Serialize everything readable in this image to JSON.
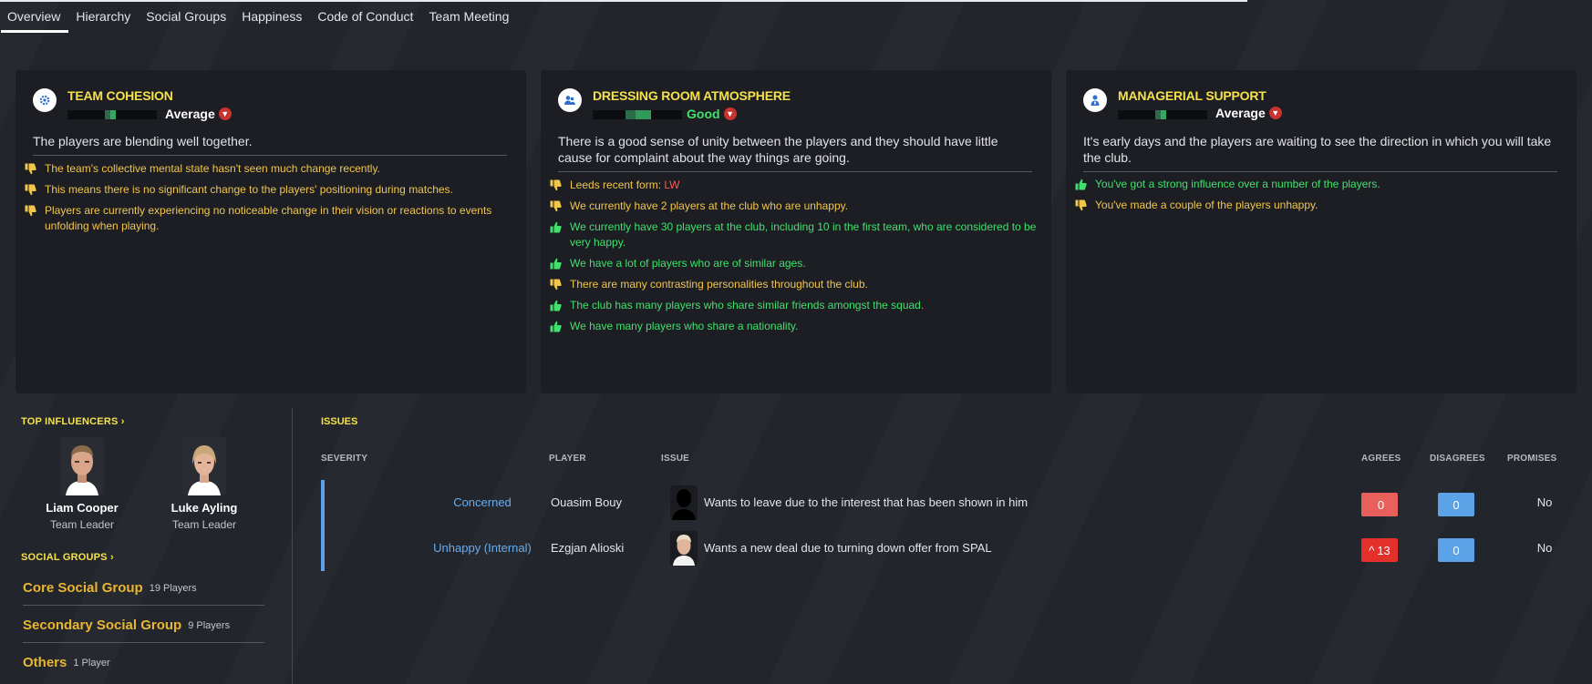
{
  "tabs": [
    "Overview",
    "Hierarchy",
    "Social Groups",
    "Happiness",
    "Code of Conduct",
    "Team Meeting"
  ],
  "cards": [
    {
      "title": "TEAM COHESION",
      "icon": "gear-icon",
      "rating": "Average",
      "rating_color": "#ffffff",
      "bar_level": 0.5,
      "summary": "The players are blending well together.",
      "factors": [
        {
          "type": "neg",
          "text": "The team's collective mental state hasn't seen much change recently."
        },
        {
          "type": "neg",
          "text": "This means there is no significant change to the players' positioning during matches."
        },
        {
          "type": "neg",
          "text": "Players are currently experiencing no noticeable change in their vision or reactions to events unfolding when playing."
        }
      ]
    },
    {
      "title": "DRESSING ROOM ATMOSPHERE",
      "icon": "people-icon",
      "rating": "Good",
      "rating_color": "#42e06e",
      "bar_level": 0.65,
      "summary": "There is a good sense of unity between the players and they should have little cause for complaint about the way things are going.",
      "factors": [
        {
          "type": "neg",
          "text": "Leeds recent form: ",
          "extra": "LW"
        },
        {
          "type": "neg",
          "text": "We currently have 2 players at the club who are unhappy."
        },
        {
          "type": "pos",
          "text": "We currently have 30 players at the club, including 10 in the first team, who are considered to be very happy."
        },
        {
          "type": "pos",
          "text": "We have a lot of players who are of similar ages."
        },
        {
          "type": "neg",
          "text": "There are many contrasting personalities throughout the club."
        },
        {
          "type": "pos",
          "text": "The club has many players who share similar friends amongst the squad."
        },
        {
          "type": "pos",
          "text": "We have many players who share a nationality."
        }
      ]
    },
    {
      "title": "MANAGERIAL SUPPORT",
      "icon": "manager-icon",
      "rating": "Average",
      "rating_color": "#ffffff",
      "bar_level": 0.5,
      "summary": "It's early days and the players are waiting to see the direction in which you will take the club.",
      "factors": [
        {
          "type": "pos",
          "text": "You've got a strong influence over a number of the players."
        },
        {
          "type": "neg",
          "text": "You've made a couple of the players unhappy."
        }
      ]
    }
  ],
  "top_influencers": {
    "title": "TOP INFLUENCERS",
    "players": [
      {
        "name": "Liam Cooper",
        "role": "Team Leader"
      },
      {
        "name": "Luke Ayling",
        "role": "Team Leader"
      }
    ]
  },
  "social_groups": {
    "title": "SOCIAL GROUPS",
    "groups": [
      {
        "name": "Core Social Group",
        "count": "19 Players"
      },
      {
        "name": "Secondary Social Group",
        "count": "9 Players"
      },
      {
        "name": "Others",
        "count": "1 Player"
      }
    ]
  },
  "issues": {
    "title": "ISSUES",
    "headers": {
      "severity": "SEVERITY",
      "player": "PLAYER",
      "issue": "ISSUE",
      "agrees": "AGREES",
      "disagrees": "DISAGREES",
      "promises": "PROMISES"
    },
    "rows": [
      {
        "severity": "Concerned",
        "player": "Ouasim Bouy",
        "issue": "Wants to leave due to the interest that has been shown in him",
        "agrees": "0",
        "agree_trend": "",
        "agree_color": "#e8605c",
        "disagrees": "0",
        "promises": "No"
      },
      {
        "severity": "Unhappy (Internal)",
        "player": "Ezgjan Alioski",
        "issue": "Wants a new deal due to turning down offer from SPAL",
        "agrees": "13",
        "agree_trend": "^",
        "agree_color": "#e3302b",
        "disagrees": "0",
        "promises": "No"
      }
    ]
  }
}
